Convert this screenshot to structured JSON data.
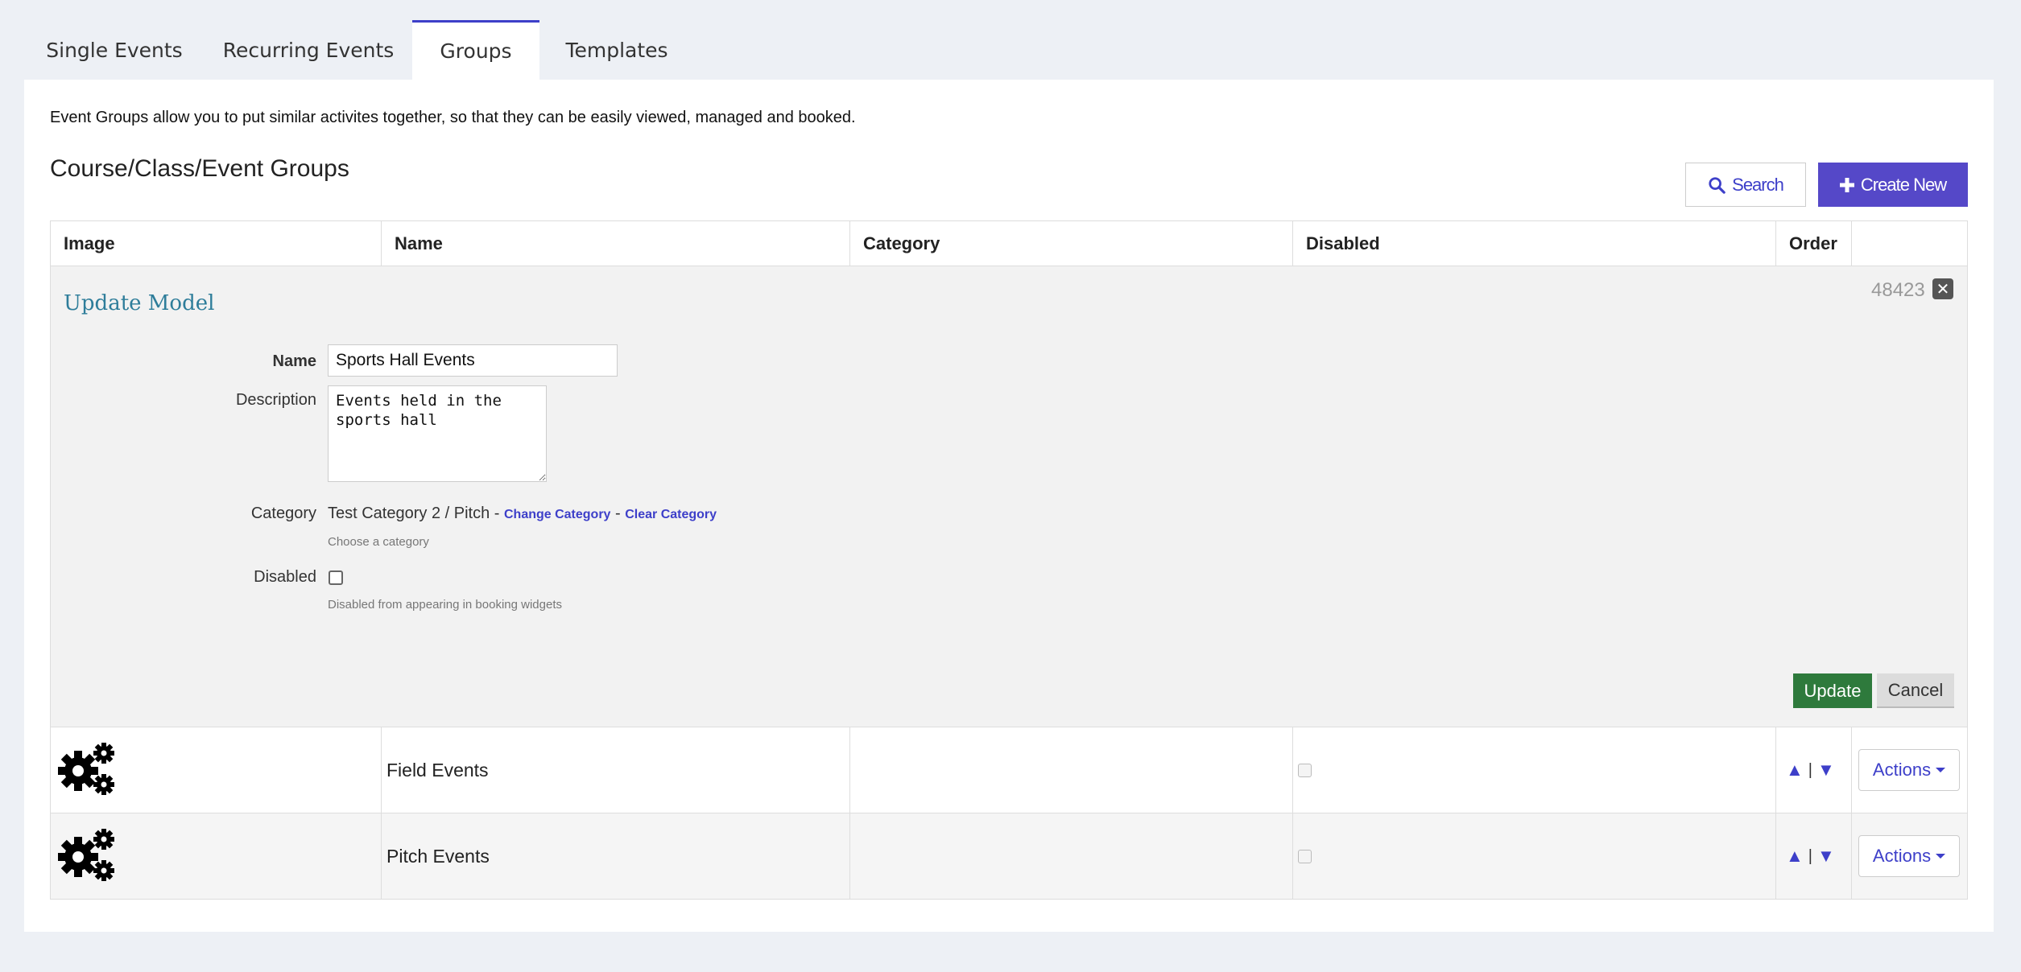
{
  "tabs": [
    {
      "label": "Single Events",
      "active": false
    },
    {
      "label": "Recurring Events",
      "active": false
    },
    {
      "label": "Groups",
      "active": true
    },
    {
      "label": "Templates",
      "active": false
    }
  ],
  "intro_text": "Event Groups allow you to put similar activites together, so that they can be easily viewed, managed and booked.",
  "page_title": "Course/Class/Event Groups",
  "toolbar": {
    "search_label": "Search",
    "create_label": "Create New"
  },
  "table": {
    "headers": [
      "Image",
      "Name",
      "Category",
      "Disabled",
      "Order",
      ""
    ]
  },
  "editor": {
    "title": "Update Model",
    "record_id": "48423",
    "name_label": "Name",
    "name_value": "Sports Hall Events",
    "description_label": "Description",
    "description_value": "Events held in the\nsports hall",
    "category_label": "Category",
    "category_value": "Test Category 2 / Pitch - ",
    "change_category": "Change Category",
    "separator": " - ",
    "clear_category": "Clear Category",
    "category_help": "Choose a category",
    "disabled_label": "Disabled",
    "disabled_checked": false,
    "disabled_help": "Disabled from appearing in booking widgets",
    "update_label": "Update",
    "cancel_label": "Cancel"
  },
  "rows": [
    {
      "name": "Field Events",
      "category": "",
      "disabled": false,
      "order_sep": "|",
      "actions_label": "Actions",
      "image_icon": "gears-icon"
    },
    {
      "name": "Pitch Events",
      "category": "",
      "disabled": false,
      "order_sep": "|",
      "actions_label": "Actions",
      "image_icon": "gears-icon"
    }
  ],
  "colors": {
    "accent": "#3d3fc9",
    "create_button": "#5548c8",
    "update_button": "#2e7a3c",
    "editor_title": "#2e7d9a",
    "page_bg": "#edf0f5"
  }
}
